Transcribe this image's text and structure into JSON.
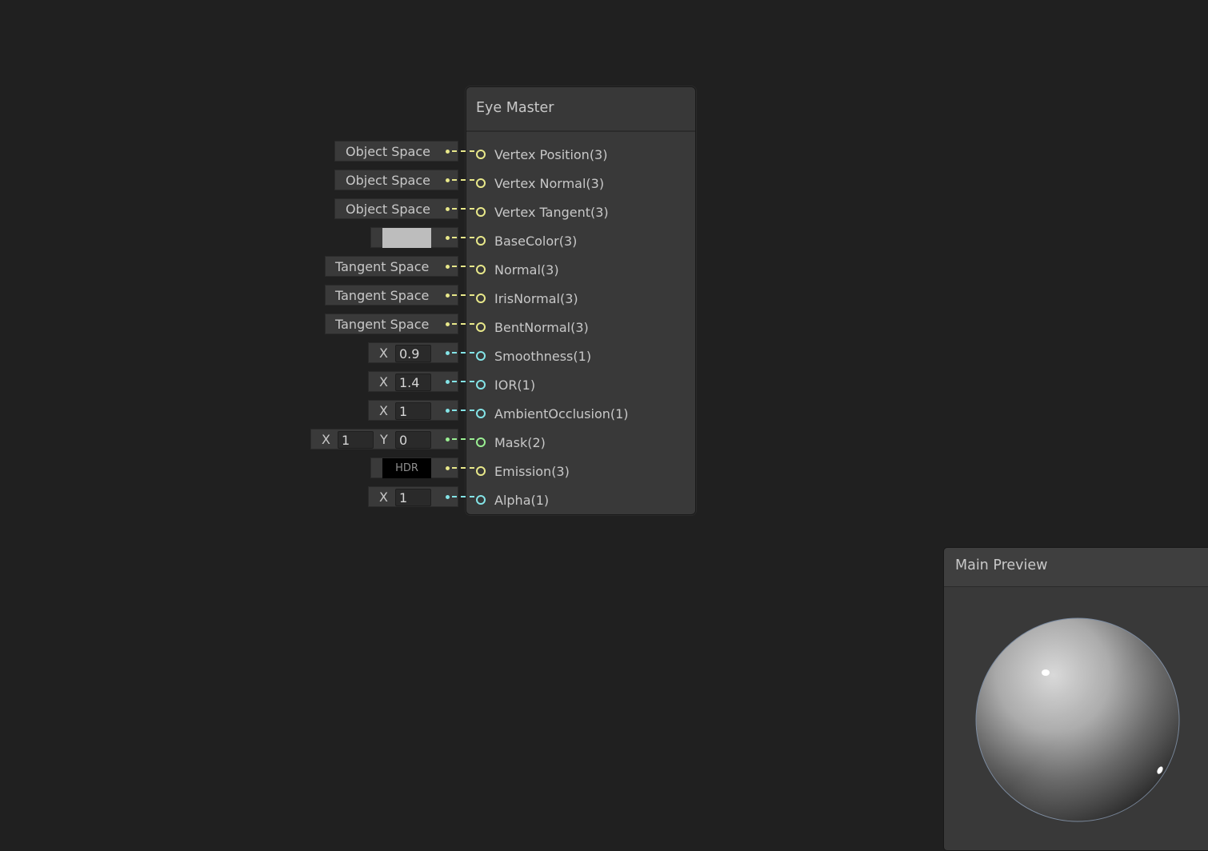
{
  "node": {
    "title": "Eye Master",
    "ports": [
      {
        "label": "Vertex Position(3)",
        "color": "#e8e88a"
      },
      {
        "label": "Vertex Normal(3)",
        "color": "#e8e88a"
      },
      {
        "label": "Vertex Tangent(3)",
        "color": "#e8e88a"
      },
      {
        "label": "BaseColor(3)",
        "color": "#e8e88a"
      },
      {
        "label": "Normal(3)",
        "color": "#e8e88a"
      },
      {
        "label": "IrisNormal(3)",
        "color": "#e8e88a"
      },
      {
        "label": "BentNormal(3)",
        "color": "#e8e88a"
      },
      {
        "label": "Smoothness(1)",
        "color": "#84e4e7"
      },
      {
        "label": "IOR(1)",
        "color": "#84e4e7"
      },
      {
        "label": "AmbientOcclusion(1)",
        "color": "#84e4e7"
      },
      {
        "label": "Mask(2)",
        "color": "#9aef92"
      },
      {
        "label": "Emission(3)",
        "color": "#e8e88a"
      },
      {
        "label": "Alpha(1)",
        "color": "#84e4e7"
      }
    ]
  },
  "inputs": {
    "vertex_position": "Object Space",
    "vertex_normal": "Object Space",
    "vertex_tangent": "Object Space",
    "base_color_swatch": "#bdbdbd",
    "normal": "Tangent Space",
    "iris_normal": "Tangent Space",
    "bent_normal": "Tangent Space",
    "smoothness": {
      "axis": "X",
      "value": "0.9"
    },
    "ior": {
      "axis": "X",
      "value": "1.4"
    },
    "ambient_occlusion": {
      "axis": "X",
      "value": "1"
    },
    "mask": {
      "x_axis": "X",
      "x_value": "1",
      "y_axis": "Y",
      "y_value": "0"
    },
    "emission": {
      "label": "HDR",
      "swatch": "#000000"
    },
    "alpha": {
      "axis": "X",
      "value": "1"
    }
  },
  "preview": {
    "title": "Main Preview"
  }
}
